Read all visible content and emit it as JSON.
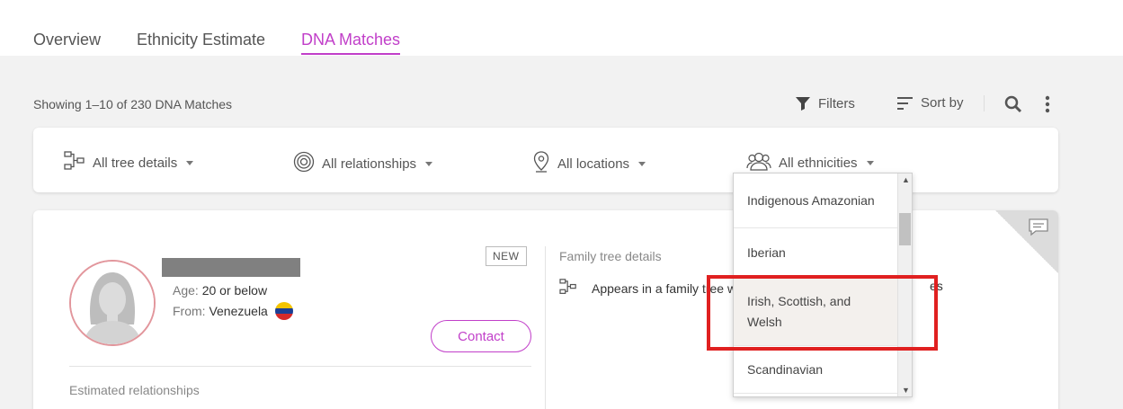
{
  "tabs": [
    {
      "label": "Overview",
      "active": false
    },
    {
      "label": "Ethnicity Estimate",
      "active": false
    },
    {
      "label": "DNA Matches",
      "active": true
    }
  ],
  "results": {
    "summary": "Showing 1–10 of 230 DNA Matches"
  },
  "toolbar": {
    "filters_label": "Filters",
    "sort_label": "Sort by",
    "search_icon": "search-icon",
    "more_icon": "more-vertical-icon"
  },
  "filter_bar": {
    "tree_details": "All tree details",
    "relationships": "All relationships",
    "locations": "All locations",
    "ethnicities": "All ethnicities"
  },
  "match": {
    "badge": "NEW",
    "age_label": "Age:",
    "age_value": "20 or below",
    "from_label": "From:",
    "from_value": "Venezuela",
    "contact_label": "Contact",
    "estimated_relationships_label": "Estimated relationships",
    "family_tree_title": "Family tree details",
    "family_tree_text": "Appears in a family tree w",
    "family_tree_suffix": "es"
  },
  "ethnicity_dropdown": {
    "options": [
      "Indigenous Amazonian",
      "Iberian",
      "Irish, Scottish, and Welsh",
      "Scandinavian"
    ],
    "highlighted": "Irish, Scottish, and Welsh"
  },
  "colors": {
    "accent": "#c13fc9",
    "annotation": "#e02020",
    "avatar_ring": "#e2969c"
  }
}
